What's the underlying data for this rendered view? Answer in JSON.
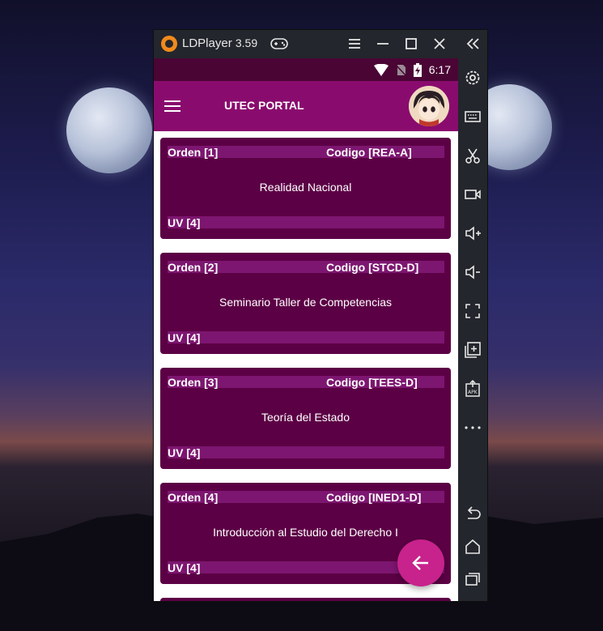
{
  "emulator": {
    "app_name": "LDPlayer",
    "version": "3.59",
    "title_icons": [
      "gamepad-icon",
      "menu-icon",
      "minimize-icon",
      "maximize-icon",
      "close-icon"
    ],
    "sidebar_icons": [
      "collapse-icon",
      "settings-icon",
      "keyboard-icon",
      "scissors-icon",
      "video-icon",
      "volume-up-icon",
      "volume-down-icon",
      "fullscreen-icon",
      "add-window-icon",
      "apk-install-icon",
      "more-icon",
      "back-icon",
      "home-icon",
      "recents-icon"
    ]
  },
  "status_bar": {
    "time": "6:17",
    "icons": [
      "wifi-icon",
      "no-sim-icon",
      "battery-charging-icon"
    ]
  },
  "app_bar": {
    "title": "UTEC PORTAL",
    "color": "#8a0b6e"
  },
  "courses": [
    {
      "orden": "Orden [1]",
      "codigo": "Codigo [REA-A]",
      "name": "Realidad Nacional",
      "uv": "UV [4]"
    },
    {
      "orden": "Orden [2]",
      "codigo": "Codigo [STCD-D]",
      "name": "Seminario Taller de Competencias",
      "uv": "UV [4]"
    },
    {
      "orden": "Orden [3]",
      "codigo": "Codigo [TEES-D]",
      "name": "Teoría del Estado",
      "uv": "UV [4]"
    },
    {
      "orden": "Orden [4]",
      "codigo": "Codigo [INED1-D]",
      "name": "Introducción al Estudio del Derecho I",
      "uv": "UV [4]"
    }
  ],
  "fab": {
    "icon": "arrow-left-icon",
    "color": "#c8228c"
  }
}
